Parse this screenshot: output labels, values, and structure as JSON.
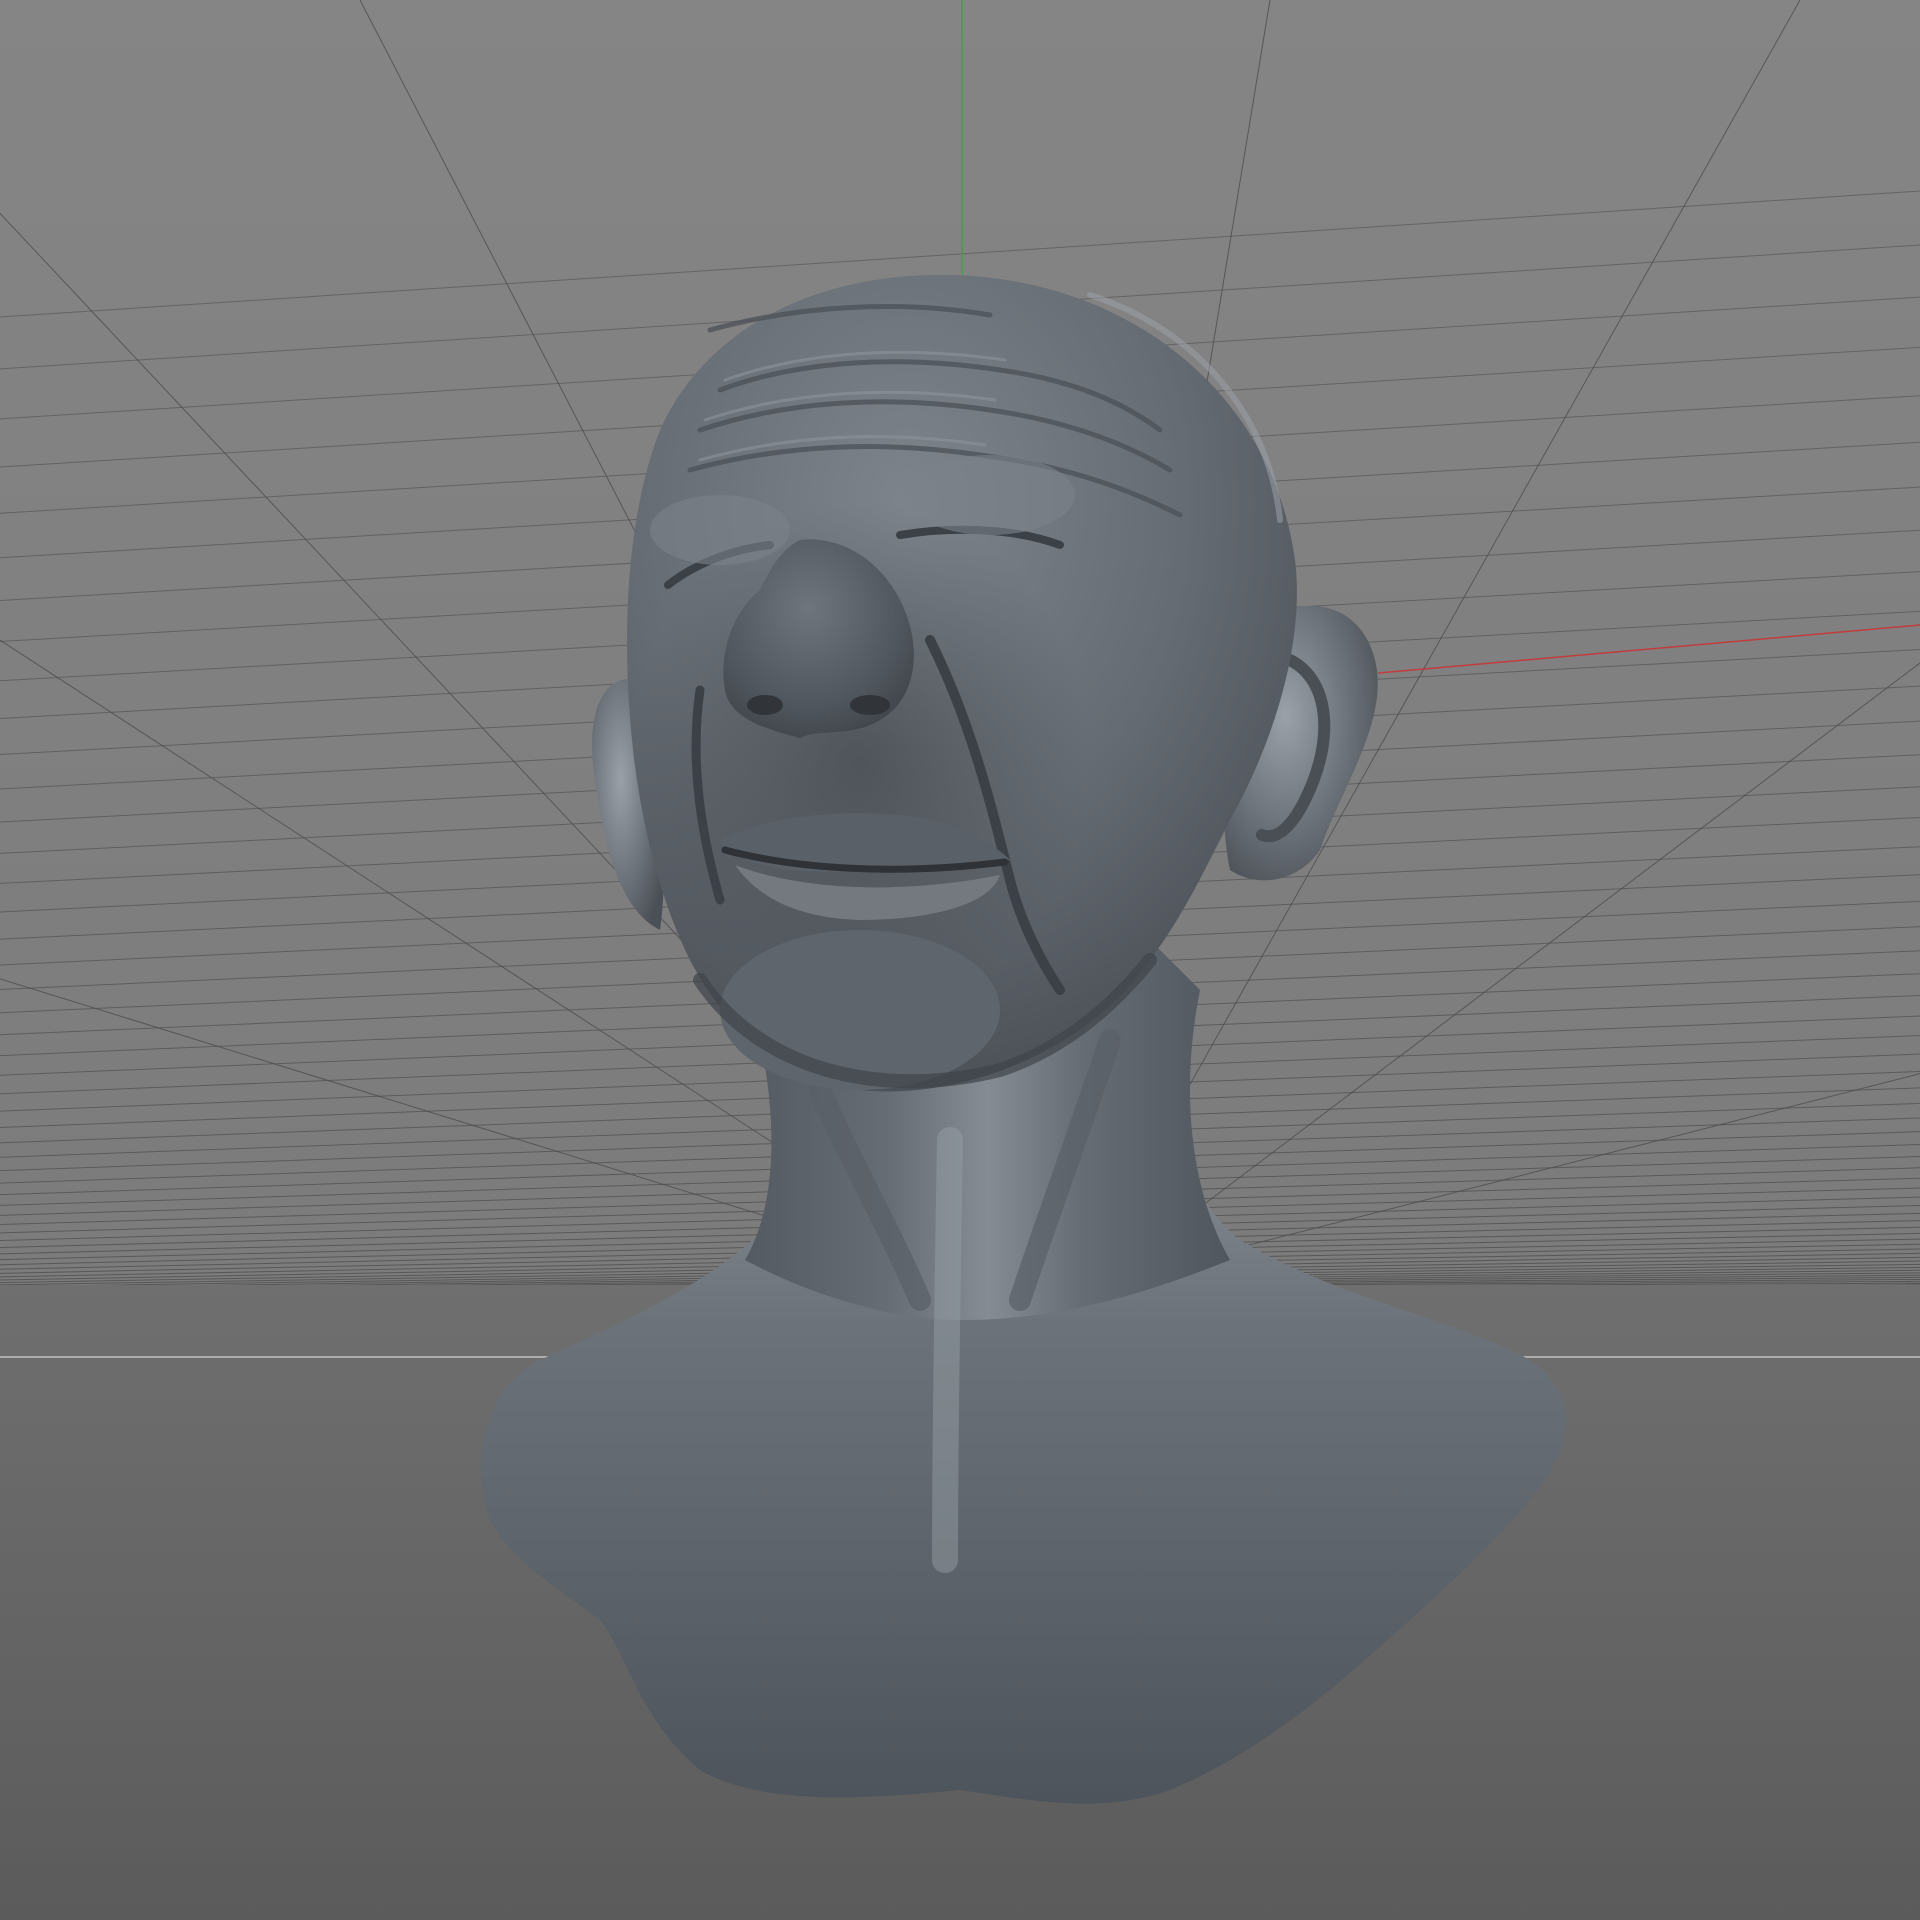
{
  "viewport": {
    "view": "perspective",
    "shading": "clay",
    "grid_visible": true,
    "axes": {
      "x_color": "#c23b3b",
      "y_color": "#3aa63a"
    },
    "colors": {
      "sky_top": "#858585",
      "sky_bottom": "#7b7b7b",
      "floor_top": "#6f6f6f",
      "floor_bottom": "#5b5b5b",
      "grid_line": "#4c4c4c",
      "horizon_line": "#c4c4c4",
      "model_base": "#6e747b",
      "model_shadow": "#4a4f56",
      "model_highlight": "#a6adb4"
    }
  },
  "scene": {
    "object": {
      "kind": "sculpted head bust",
      "icon": "bust-sculpt"
    }
  }
}
